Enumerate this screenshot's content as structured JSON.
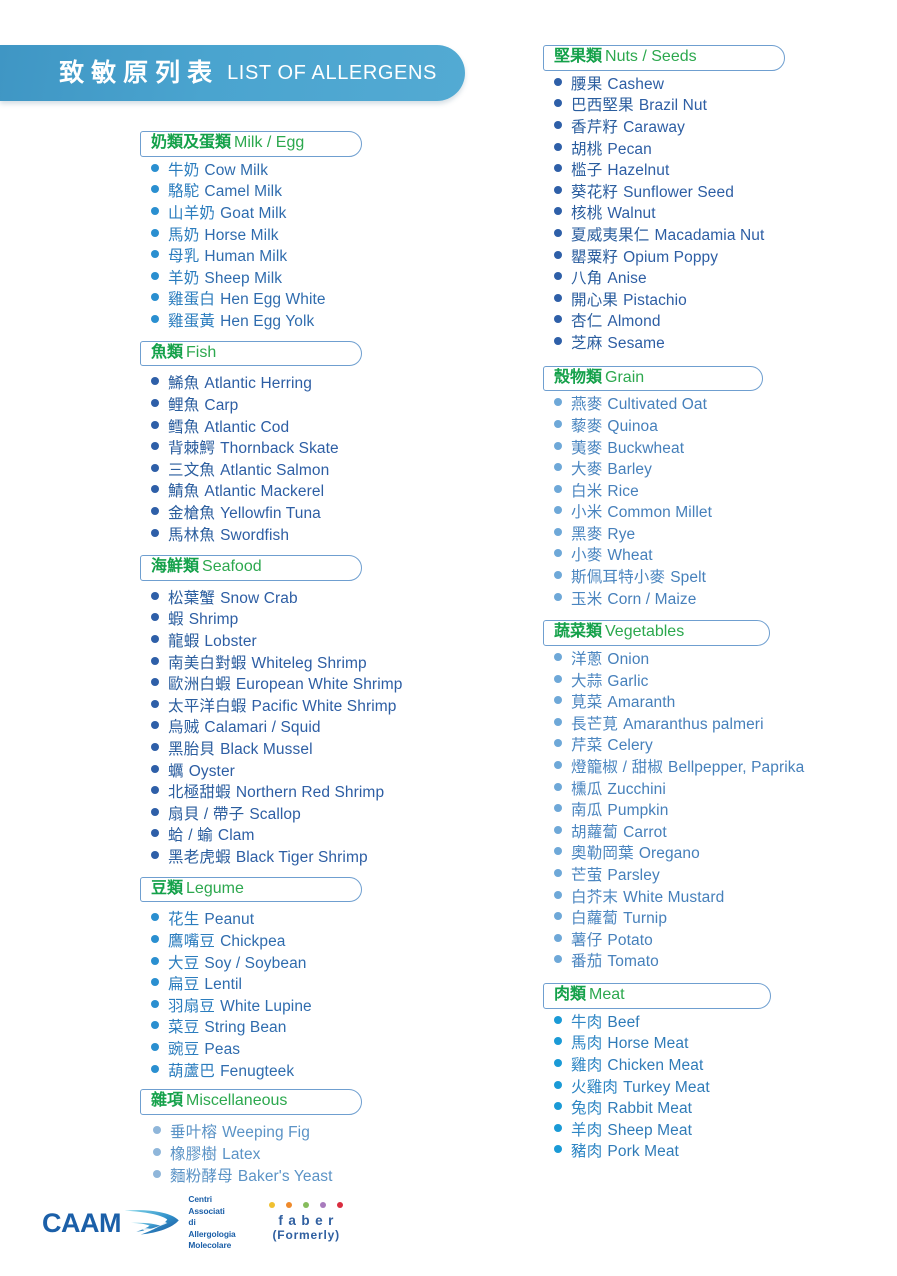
{
  "header": {
    "title_cn": "致敏原列表",
    "title_en": "LIST OF ALLERGENS",
    "banner_color": "#4aa4cf"
  },
  "colors": {
    "header_box_border": "#6f9fd0",
    "header_text_cn": "#14a14a",
    "header_text_en": "#2ca84e",
    "item_text": "#2f7fc0"
  },
  "left_column": [
    {
      "id": "milk-egg",
      "head_cn": "奶類及蛋類",
      "head_en": "Milk / Egg",
      "items": [
        {
          "cn": "牛奶",
          "en": "Cow Milk"
        },
        {
          "cn": "駱駝",
          "en": "Camel Milk"
        },
        {
          "cn": "山羊奶",
          "en": "Goat Milk"
        },
        {
          "cn": "馬奶",
          "en": "Horse Milk"
        },
        {
          "cn": "母乳",
          "en": "Human Milk"
        },
        {
          "cn": "羊奶",
          "en": "Sheep Milk"
        },
        {
          "cn": "雞蛋白",
          "en": "Hen Egg White"
        },
        {
          "cn": "雞蛋黃",
          "en": "Hen Egg Yolk"
        }
      ]
    },
    {
      "id": "fish",
      "head_cn": "魚類",
      "head_en": "Fish",
      "items": [
        {
          "cn": "鯑魚",
          "en": "Atlantic Herring"
        },
        {
          "cn": "鲤魚",
          "en": "Carp"
        },
        {
          "cn": "鳕魚",
          "en": "Atlantic Cod"
        },
        {
          "cn": "背棘鰐",
          "en": "Thornback Skate"
        },
        {
          "cn": "三文魚",
          "en": "Atlantic Salmon"
        },
        {
          "cn": "鯖魚",
          "en": "Atlantic Mackerel"
        },
        {
          "cn": "金槍魚",
          "en": "Yellowfin Tuna"
        },
        {
          "cn": "馬林魚",
          "en": "Swordfish"
        }
      ]
    },
    {
      "id": "seafood",
      "head_cn": "海鮮類",
      "head_en": "Seafood",
      "items": [
        {
          "cn": "松葉蟹",
          "en": "Snow Crab"
        },
        {
          "cn": "蝦",
          "en": "Shrimp"
        },
        {
          "cn": "龍蝦",
          "en": "Lobster"
        },
        {
          "cn": "南美白對蝦",
          "en": "Whiteleg Shrimp"
        },
        {
          "cn": "歐洲白蝦",
          "en": "European White Shrimp"
        },
        {
          "cn": "太平洋白蝦",
          "en": "Pacific White Shrimp"
        },
        {
          "cn": "烏贼",
          "en": "Calamari / Squid"
        },
        {
          "cn": "黑胎貝",
          "en": "Black Mussel"
        },
        {
          "cn": "蠣",
          "en": "Oyster"
        },
        {
          "cn": "北極甜蝦",
          "en": "Northern Red Shrimp"
        },
        {
          "cn": "扇貝 / 帶子",
          "en": "Scallop"
        },
        {
          "cn": "蛤 / 蝓",
          "en": "Clam"
        },
        {
          "cn": "黑老虎蝦",
          "en": "Black Tiger Shrimp"
        }
      ]
    },
    {
      "id": "legume",
      "head_cn": "豆類",
      "head_en": "Legume",
      "items": [
        {
          "cn": "花生",
          "en": "Peanut"
        },
        {
          "cn": "鷹嘴豆",
          "en": "Chickpea"
        },
        {
          "cn": "大豆",
          "en": "Soy / Soybean"
        },
        {
          "cn": "扁豆",
          "en": "Lentil"
        },
        {
          "cn": "羽扇豆",
          "en": "White Lupine"
        },
        {
          "cn": "菜豆",
          "en": "String Bean"
        },
        {
          "cn": "豌豆",
          "en": "Peas"
        },
        {
          "cn": "葫蘆巴",
          "en": "Fenugteek"
        }
      ]
    },
    {
      "id": "miscellaneous",
      "head_cn": "雜項",
      "head_en": "Miscellaneous",
      "items": [
        {
          "cn": "垂叶榕",
          "en": "Weeping Fig"
        },
        {
          "cn": "橡膠樹",
          "en": "Latex"
        },
        {
          "cn": "麵粉酵母",
          "en": "Baker's Yeast"
        }
      ]
    }
  ],
  "right_column": [
    {
      "id": "nuts-seeds",
      "head_cn": "堅果類",
      "head_en": "Nuts / Seeds",
      "items": [
        {
          "cn": "腰果",
          "en": "Cashew"
        },
        {
          "cn": "巴西堅果",
          "en": "Brazil Nut"
        },
        {
          "cn": "香芹籽",
          "en": "Caraway"
        },
        {
          "cn": "胡桃",
          "en": "Pecan"
        },
        {
          "cn": "槛子",
          "en": "Hazelnut"
        },
        {
          "cn": "葵花籽",
          "en": "Sunflower Seed"
        },
        {
          "cn": "核桃",
          "en": "Walnut"
        },
        {
          "cn": "夏威夷果仁",
          "en": "Macadamia Nut"
        },
        {
          "cn": "罌粟籽",
          "en": "Opium Poppy"
        },
        {
          "cn": "八角",
          "en": "Anise"
        },
        {
          "cn": "開心果",
          "en": "Pistachio"
        },
        {
          "cn": "杏仁",
          "en": "Almond"
        },
        {
          "cn": "芝麻",
          "en": "Sesame"
        }
      ]
    },
    {
      "id": "grain",
      "head_cn": "殼物類",
      "head_en": "Grain",
      "items": [
        {
          "cn": "燕麥",
          "en": "Cultivated Oat"
        },
        {
          "cn": "藜麥",
          "en": "Quinoa"
        },
        {
          "cn": "荑麥",
          "en": "Buckwheat"
        },
        {
          "cn": "大麥",
          "en": "Barley"
        },
        {
          "cn": "白米",
          "en": "Rice"
        },
        {
          "cn": "小米",
          "en": "Common Millet"
        },
        {
          "cn": "黑麥",
          "en": "Rye"
        },
        {
          "cn": "小麥",
          "en": "Wheat"
        },
        {
          "cn": "斯佩耳特小麥",
          "en": "Spelt"
        },
        {
          "cn": "玉米",
          "en": "Corn / Maize"
        }
      ]
    },
    {
      "id": "vegetables",
      "head_cn": "蔬菜類",
      "head_en": "Vegetables",
      "items": [
        {
          "cn": "洋蔥",
          "en": "Onion"
        },
        {
          "cn": "大蒜",
          "en": "Garlic"
        },
        {
          "cn": "莧菜",
          "en": "Amaranth"
        },
        {
          "cn": "長芒莧",
          "en": "Amaranthus palmeri"
        },
        {
          "cn": "芹菜",
          "en": "Celery"
        },
        {
          "cn": "燈籠椒 / 甜椒",
          "en": "Bellpepper, Paprika"
        },
        {
          "cn": "櫄瓜",
          "en": "Zucchini"
        },
        {
          "cn": "南瓜",
          "en": "Pumpkin"
        },
        {
          "cn": "胡蘿蔔",
          "en": "Carrot"
        },
        {
          "cn": "奧勒岡葉",
          "en": "Oregano"
        },
        {
          "cn": "芒萤",
          "en": "Parsley"
        },
        {
          "cn": "白芥末",
          "en": "White Mustard"
        },
        {
          "cn": "白蘿蔔",
          "en": "Turnip"
        },
        {
          "cn": "薯仔",
          "en": "Potato"
        },
        {
          "cn": "番茄",
          "en": "Tomato"
        }
      ]
    },
    {
      "id": "meat",
      "head_cn": "肉類",
      "head_en": "Meat",
      "items": [
        {
          "cn": "牛肉",
          "en": "Beef"
        },
        {
          "cn": "馬肉",
          "en": "Horse Meat"
        },
        {
          "cn": "雞肉",
          "en": "Chicken Meat"
        },
        {
          "cn": "火雞肉",
          "en": "Turkey Meat"
        },
        {
          "cn": "兔肉",
          "en": "Rabbit Meat"
        },
        {
          "cn": "羊肉",
          "en": "Sheep Meat"
        },
        {
          "cn": "豬肉",
          "en": "Pork Meat"
        }
      ]
    }
  ],
  "footer": {
    "caam_name": "CAAM",
    "caam_line1": "Centri Associati",
    "caam_line2": "di Allergologia",
    "caam_line3": "Molecolare",
    "faber_word": "faber",
    "faber_formerly": "(Formerly)",
    "faber_dot_colors": [
      "#f0c030",
      "#ef8a2b",
      "#86bc5c",
      "#a87bbd",
      "#d92c3f"
    ]
  }
}
